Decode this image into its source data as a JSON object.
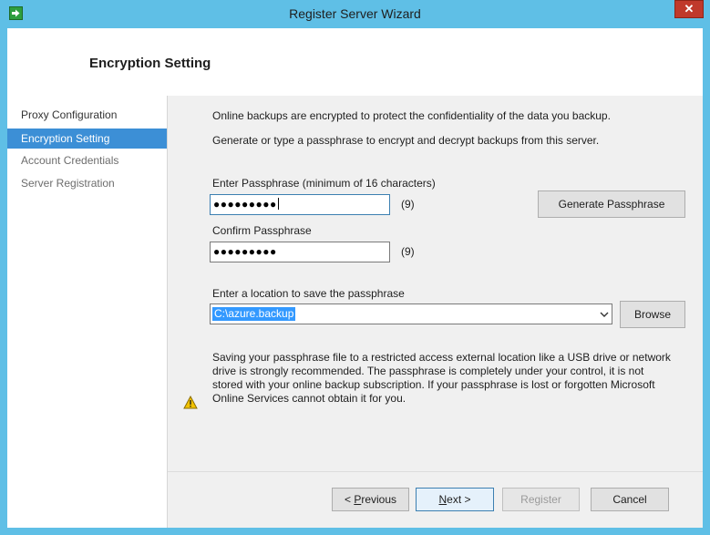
{
  "window": {
    "title": "Register Server Wizard",
    "close_glyph": "✕"
  },
  "header": {
    "title": "Encryption Setting"
  },
  "sidebar": {
    "items": [
      {
        "label": "Proxy Configuration",
        "state": "visited"
      },
      {
        "label": "Encryption Setting",
        "state": "active"
      },
      {
        "label": "Account Credentials",
        "state": "pending"
      },
      {
        "label": "Server Registration",
        "state": "pending"
      }
    ]
  },
  "main": {
    "intro1": "Online backups are encrypted to protect the confidentiality of the data you backup.",
    "intro2": "Generate or type a passphrase to encrypt and decrypt backups from this server.",
    "passphrase_label": "Enter Passphrase (minimum of 16 characters)",
    "passphrase_value": "●●●●●●●●●",
    "passphrase_count": "(9)",
    "generate_button": "Generate Passphrase",
    "confirm_label": "Confirm Passphrase",
    "confirm_value": "●●●●●●●●●",
    "confirm_count": "(9)",
    "location_label": "Enter a location to save the passphrase",
    "location_value": "C:\\azure.backup",
    "browse_button": "Browse",
    "warning_lines": [
      "Saving your passphrase file to a restricted access external location like a USB drive or network",
      "drive is strongly recommended. The passphrase is completely under your control, it is not",
      "stored with your online backup subscription. If your passphrase is lost or forgotten Microsoft",
      "Online Services cannot obtain it for you."
    ]
  },
  "footer": {
    "previous_prefix": "< ",
    "previous_hotkey": "P",
    "previous_rest": "revious",
    "next_hotkey": "N",
    "next_rest": "ext >",
    "register": "Register",
    "cancel": "Cancel"
  },
  "colors": {
    "titlebar": "#5fbfe6",
    "active_nav": "#3c8fd6",
    "selection": "#3399ff",
    "warning_icon": "#f2c200"
  }
}
